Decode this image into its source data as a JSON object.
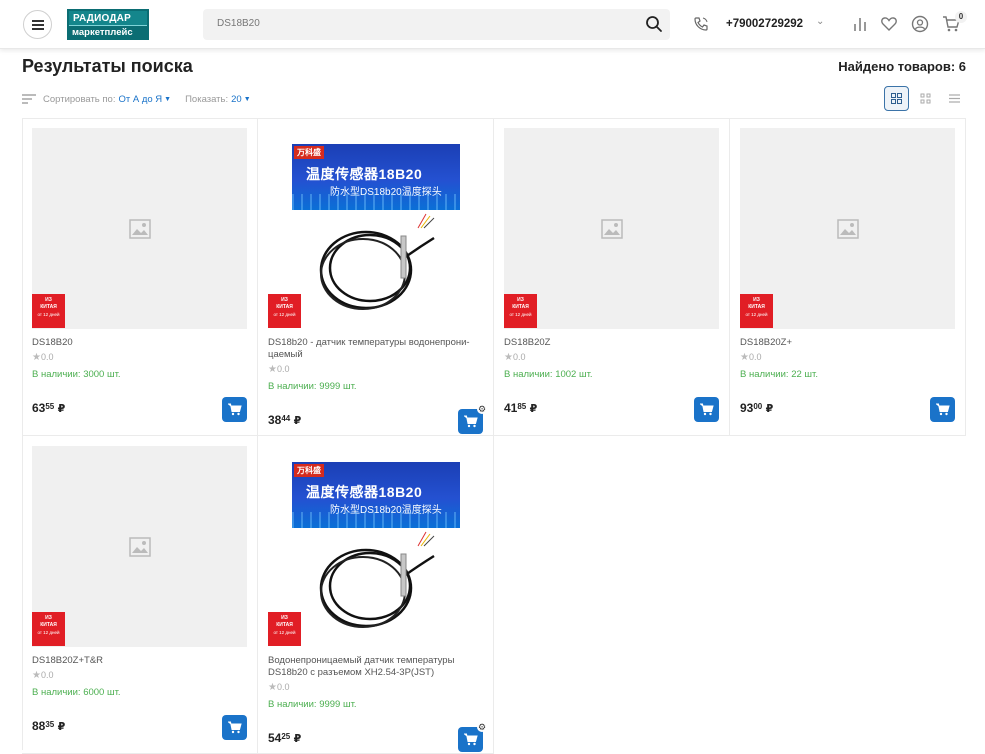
{
  "header": {
    "logo_line1": "РАДИОДАР",
    "logo_line2": "маркетплейс",
    "search_value": "DS18B20",
    "phone": "+79002729292",
    "cart_count": "0"
  },
  "page": {
    "title": "Результаты поиска",
    "found": "Найдено товаров: 6",
    "sort_label": "Сортировать по:",
    "sort_value": "От А до Я",
    "show_label": "Показать:",
    "show_value": "20"
  },
  "badge": {
    "l1": "ИЗ",
    "l2": "КИТАЯ",
    "l3": "от 12 дней"
  },
  "photo": {
    "brand": "万科盛",
    "title": "温度传感器18B20",
    "subtitle": "防水型DS18b20温度探头"
  },
  "products": [
    {
      "name": "DS18B20",
      "rating": "0.0",
      "stock": "В наличии: 3000 шт.",
      "price_int": "63",
      "price_frac": "55",
      "currency": "₽"
    },
    {
      "name": "DS18b20 - датчик температуры водонепрони-цаемый",
      "rating": "0.0",
      "stock": "В наличии: 9999 шт.",
      "price_int": "38",
      "price_frac": "44",
      "currency": "₽"
    },
    {
      "name": "DS18B20Z",
      "rating": "0.0",
      "stock": "В наличии: 1002 шт.",
      "price_int": "41",
      "price_frac": "85",
      "currency": "₽"
    },
    {
      "name": "DS18B20Z+",
      "rating": "0.0",
      "stock": "В наличии: 22 шт.",
      "price_int": "93",
      "price_frac": "00",
      "currency": "₽"
    },
    {
      "name": "DS18B20Z+T&R",
      "rating": "0.0",
      "stock": "В наличии: 6000 шт.",
      "price_int": "88",
      "price_frac": "35",
      "currency": "₽"
    },
    {
      "name": "Водонепроницаемый датчик температуры DS18b20 с разъемом XH2.54-3P(JST)",
      "rating": "0.0",
      "stock": "В наличии: 9999 шт.",
      "price_int": "54",
      "price_frac": "25",
      "currency": "₽"
    }
  ],
  "icons": {
    "menu": "hamburger-icon",
    "search": "search-icon",
    "phone": "phone-icon",
    "compare": "compare-icon",
    "favorite": "heart-icon",
    "account": "user-icon",
    "cart": "cart-icon"
  },
  "colors": {
    "accent": "#1a73c9",
    "stock": "#4caf50",
    "badge": "#e11e25",
    "logo": "#0b6d73"
  }
}
